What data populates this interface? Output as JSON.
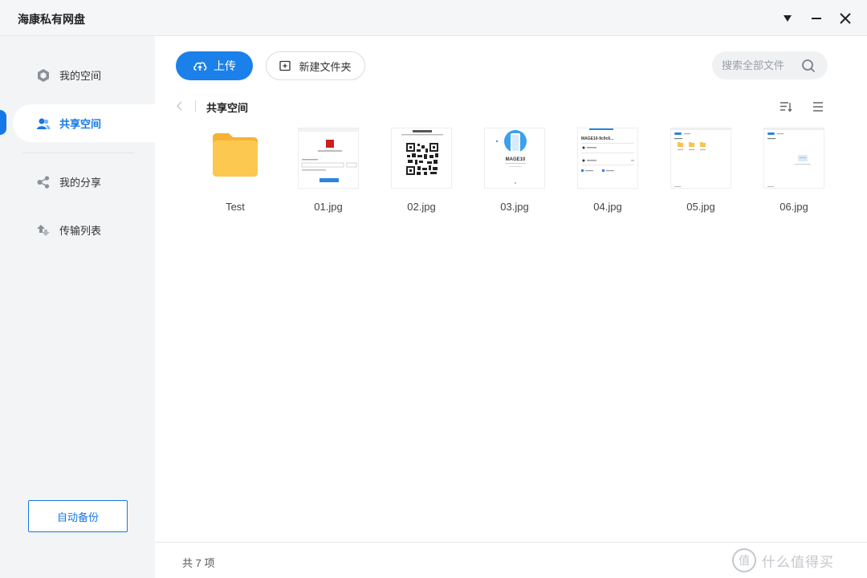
{
  "app": {
    "title": "海康私有网盘"
  },
  "sidebar": {
    "items": [
      {
        "label": "我的空间",
        "icon": "hexagon-icon"
      },
      {
        "label": "共享空间",
        "icon": "users-icon",
        "active": true
      },
      {
        "label": "我的分享",
        "icon": "share-icon"
      },
      {
        "label": "传输列表",
        "icon": "transfer-icon"
      }
    ],
    "backup_label": "自动备份"
  },
  "toolbar": {
    "upload_label": "上传",
    "new_folder_label": "新建文件夹",
    "search_placeholder": "搜索全部文件"
  },
  "breadcrumb": {
    "current": "共享空间"
  },
  "files": [
    {
      "name": "Test",
      "type": "folder"
    },
    {
      "name": "01.jpg",
      "type": "image"
    },
    {
      "name": "02.jpg",
      "type": "image"
    },
    {
      "name": "03.jpg",
      "type": "image"
    },
    {
      "name": "04.jpg",
      "type": "image"
    },
    {
      "name": "05.jpg",
      "type": "image"
    },
    {
      "name": "06.jpg",
      "type": "image"
    }
  ],
  "status": {
    "count_text": "共 7 项"
  },
  "thumb_text": {
    "t03_model": "MAGE10",
    "t04_model": "MAGE10-9c9c6..."
  },
  "watermark": {
    "text": "什么值得买",
    "logo_char": "值"
  },
  "colors": {
    "accent": "#1677e6",
    "folder": "#fbc34a"
  }
}
